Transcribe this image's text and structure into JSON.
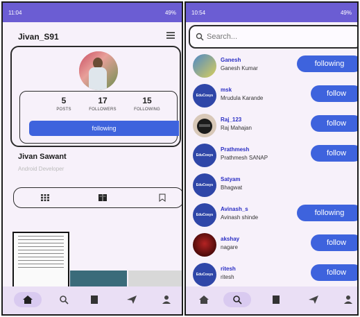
{
  "left": {
    "status": {
      "time": "11:04",
      "battery": "49%"
    },
    "username": "Jivan_S91",
    "stats": [
      {
        "value": "5",
        "label": "POSTS"
      },
      {
        "value": "17",
        "label": "FOLLOWERS"
      },
      {
        "value": "15",
        "label": "FOLLOWING"
      }
    ],
    "following_button": "following",
    "display_name": "Jivan Sawant",
    "bio": "Android Developer"
  },
  "right": {
    "status": {
      "time": "10:54",
      "battery": "49%"
    },
    "search_placeholder": "Search...",
    "users": [
      {
        "handle": "Ganesh",
        "name": "Ganesh Kumar",
        "action": "following",
        "avatar": "photo"
      },
      {
        "handle": "msk",
        "name": "Mrudula Karande",
        "action": "follow",
        "avatar": "educosys-logo"
      },
      {
        "handle": "Raj_123",
        "name": "Raj Mahajan",
        "action": "follow",
        "avatar": "photo"
      },
      {
        "handle": "Prathmesh",
        "name": "Prathmesh SANAP",
        "action": "follow",
        "avatar": "educosys-logo"
      },
      {
        "handle": "Satyam",
        "name": "Bhagwat",
        "action": "",
        "avatar": "educosys-logo"
      },
      {
        "handle": "Avinash_s",
        "name": "Avinash shinde",
        "action": "following",
        "avatar": "educosys-logo"
      },
      {
        "handle": "akshay",
        "name": "nagare",
        "action": "follow",
        "avatar": "photo"
      },
      {
        "handle": "ritesh",
        "name": "ritesh",
        "action": "follow",
        "avatar": "educosys-logo"
      }
    ]
  },
  "nav_icons": [
    "home-icon",
    "search-icon",
    "reels-icon",
    "send-icon",
    "profile-icon"
  ],
  "colors": {
    "accent": "#3e63dd",
    "status_bar": "#6b5dd3",
    "background": "#f7f1fa",
    "nav_bg": "#eadff5"
  }
}
